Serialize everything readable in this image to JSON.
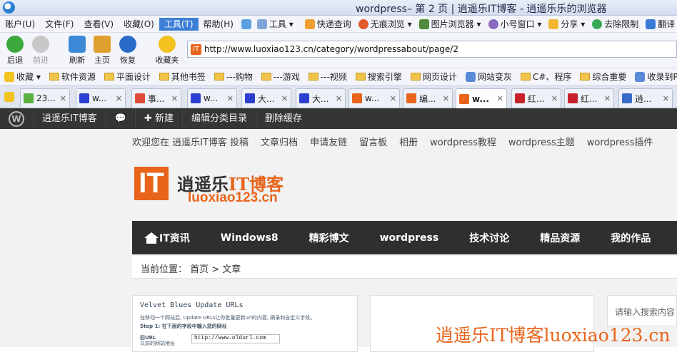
{
  "window": {
    "title": "wordpress– 第 2 页 | 逍遥乐IT博客 - 逍遥乐乐的浏览器"
  },
  "menu": {
    "items": [
      "账户(U)",
      "文件(F)",
      "查看(V)",
      "收藏(O)",
      "工具(T)",
      "帮助(H)"
    ],
    "active": "工具(T)",
    "tools": [
      "工具",
      "快递查询",
      "无痕浏览",
      "图片浏览器",
      "小号窗口",
      "分享",
      "去除限制",
      "翻译"
    ]
  },
  "nav": {
    "back": "后退",
    "forward": "前进",
    "refresh": "刷新",
    "home": "主页",
    "restore": "恢复",
    "favorites": "收藏夹"
  },
  "address": {
    "url": "http://www.luoxiao123.cn/category/wordpressabout/page/2"
  },
  "bookmarks": [
    "收藏",
    "软件资源",
    "平面设计",
    "其他书签",
    "---购物",
    "---游戏",
    "---视频",
    "搜索引擎",
    "网页设计",
    "网站变灰",
    "C#、程序",
    "综合重要",
    "收录到PO"
  ],
  "tabs": [
    "23...",
    "w...",
    "事...",
    "w...",
    "大...",
    "大...",
    "w...",
    "编...",
    "w...",
    "w...",
    "红...",
    "红...",
    "逍..."
  ],
  "wpadmin": {
    "site": "逍遥乐IT博客",
    "new": "新建",
    "edit_cat": "编辑分类目录",
    "clear_cache": "删除缓存"
  },
  "site": {
    "topnav": [
      "欢迎您在 逍遥乐IT博客 投稿",
      "文章归档",
      "申请友链",
      "留言板",
      "相册",
      "wordpress教程",
      "wordpress主题",
      "wordpress插件"
    ],
    "logo_it": "IT",
    "logo_cn_a": "逍遥乐",
    "logo_cn_b": "IT博客",
    "logo_url": "luoxiao123.cn",
    "mainnav": [
      "IT资讯",
      "Windows8",
      "精彩博文",
      "wordpress",
      "技术讨论",
      "精品资源",
      "我的作品"
    ],
    "breadcrumb": "当前位置：  首页 > 文章",
    "card1_title": "Velvet Blues Update URLs",
    "card1_line1": "在移动一个网站后, Update URLs让你批量更新url的内容, 摘录和自定义字段。",
    "card1_step": "Step 1: 在下面的字段中输入您的网址",
    "card1_label1": "旧URL",
    "card1_label2": "以前的网站地址",
    "card1_input": "http://www.oldurl.com",
    "search_placeholder": "请输入搜索内容",
    "watermark": "逍遥乐IT博客luoxiao123.cn"
  },
  "colors": {
    "accent": "#e8641b",
    "adminbar": "#353535",
    "mainnav": "#2f2f2f"
  }
}
